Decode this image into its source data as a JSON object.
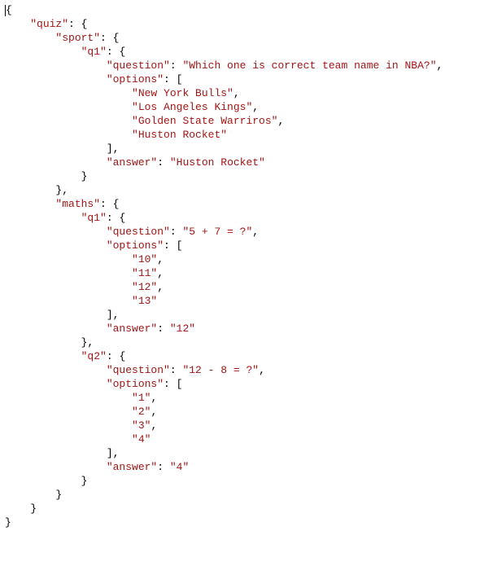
{
  "code_lines": [
    [
      [
        "p",
        "{"
      ]
    ],
    [
      [
        "p",
        "    "
      ],
      [
        "s",
        "\"quiz\""
      ],
      [
        "p",
        ": {"
      ]
    ],
    [
      [
        "p",
        "        "
      ],
      [
        "s",
        "\"sport\""
      ],
      [
        "p",
        ": {"
      ]
    ],
    [
      [
        "p",
        "            "
      ],
      [
        "s",
        "\"q1\""
      ],
      [
        "p",
        ": {"
      ]
    ],
    [
      [
        "p",
        "                "
      ],
      [
        "s",
        "\"question\""
      ],
      [
        "p",
        ": "
      ],
      [
        "s",
        "\"Which one is correct team name in NBA?\""
      ],
      [
        "p",
        ","
      ]
    ],
    [
      [
        "p",
        "                "
      ],
      [
        "s",
        "\"options\""
      ],
      [
        "p",
        ": ["
      ]
    ],
    [
      [
        "p",
        "                    "
      ],
      [
        "s",
        "\"New York Bulls\""
      ],
      [
        "p",
        ","
      ]
    ],
    [
      [
        "p",
        "                    "
      ],
      [
        "s",
        "\"Los Angeles Kings\""
      ],
      [
        "p",
        ","
      ]
    ],
    [
      [
        "p",
        "                    "
      ],
      [
        "s",
        "\"Golden State Warriros\""
      ],
      [
        "p",
        ","
      ]
    ],
    [
      [
        "p",
        "                    "
      ],
      [
        "s",
        "\"Huston Rocket\""
      ]
    ],
    [
      [
        "p",
        "                ],"
      ]
    ],
    [
      [
        "p",
        "                "
      ],
      [
        "s",
        "\"answer\""
      ],
      [
        "p",
        ": "
      ],
      [
        "s",
        "\"Huston Rocket\""
      ]
    ],
    [
      [
        "p",
        "            }"
      ]
    ],
    [
      [
        "p",
        "        },"
      ]
    ],
    [
      [
        "p",
        "        "
      ],
      [
        "s",
        "\"maths\""
      ],
      [
        "p",
        ": {"
      ]
    ],
    [
      [
        "p",
        "            "
      ],
      [
        "s",
        "\"q1\""
      ],
      [
        "p",
        ": {"
      ]
    ],
    [
      [
        "p",
        "                "
      ],
      [
        "s",
        "\"question\""
      ],
      [
        "p",
        ": "
      ],
      [
        "s",
        "\"5 + 7 = ?\""
      ],
      [
        "p",
        ","
      ]
    ],
    [
      [
        "p",
        "                "
      ],
      [
        "s",
        "\"options\""
      ],
      [
        "p",
        ": ["
      ]
    ],
    [
      [
        "p",
        "                    "
      ],
      [
        "s",
        "\"10\""
      ],
      [
        "p",
        ","
      ]
    ],
    [
      [
        "p",
        "                    "
      ],
      [
        "s",
        "\"11\""
      ],
      [
        "p",
        ","
      ]
    ],
    [
      [
        "p",
        "                    "
      ],
      [
        "s",
        "\"12\""
      ],
      [
        "p",
        ","
      ]
    ],
    [
      [
        "p",
        "                    "
      ],
      [
        "s",
        "\"13\""
      ]
    ],
    [
      [
        "p",
        "                ],"
      ]
    ],
    [
      [
        "p",
        "                "
      ],
      [
        "s",
        "\"answer\""
      ],
      [
        "p",
        ": "
      ],
      [
        "s",
        "\"12\""
      ]
    ],
    [
      [
        "p",
        "            },"
      ]
    ],
    [
      [
        "p",
        "            "
      ],
      [
        "s",
        "\"q2\""
      ],
      [
        "p",
        ": {"
      ]
    ],
    [
      [
        "p",
        "                "
      ],
      [
        "s",
        "\"question\""
      ],
      [
        "p",
        ": "
      ],
      [
        "s",
        "\"12 - 8 = ?\""
      ],
      [
        "p",
        ","
      ]
    ],
    [
      [
        "p",
        "                "
      ],
      [
        "s",
        "\"options\""
      ],
      [
        "p",
        ": ["
      ]
    ],
    [
      [
        "p",
        "                    "
      ],
      [
        "s",
        "\"1\""
      ],
      [
        "p",
        ","
      ]
    ],
    [
      [
        "p",
        "                    "
      ],
      [
        "s",
        "\"2\""
      ],
      [
        "p",
        ","
      ]
    ],
    [
      [
        "p",
        "                    "
      ],
      [
        "s",
        "\"3\""
      ],
      [
        "p",
        ","
      ]
    ],
    [
      [
        "p",
        "                    "
      ],
      [
        "s",
        "\"4\""
      ]
    ],
    [
      [
        "p",
        "                ],"
      ]
    ],
    [
      [
        "p",
        "                "
      ],
      [
        "s",
        "\"answer\""
      ],
      [
        "p",
        ": "
      ],
      [
        "s",
        "\"4\""
      ]
    ],
    [
      [
        "p",
        "            }"
      ]
    ],
    [
      [
        "p",
        "        }"
      ]
    ],
    [
      [
        "p",
        "    }"
      ]
    ],
    [
      [
        "p",
        "}"
      ]
    ]
  ],
  "chart_data": {
    "type": "table",
    "content_type": "json",
    "data": {
      "quiz": {
        "sport": {
          "q1": {
            "question": "Which one is correct team name in NBA?",
            "options": [
              "New York Bulls",
              "Los Angeles Kings",
              "Golden State Warriros",
              "Huston Rocket"
            ],
            "answer": "Huston Rocket"
          }
        },
        "maths": {
          "q1": {
            "question": "5 + 7 = ?",
            "options": [
              "10",
              "11",
              "12",
              "13"
            ],
            "answer": "12"
          },
          "q2": {
            "question": "12 - 8 = ?",
            "options": [
              "1",
              "2",
              "3",
              "4"
            ],
            "answer": "4"
          }
        }
      }
    }
  },
  "cursor": {
    "line": 0,
    "before_col": 0
  }
}
